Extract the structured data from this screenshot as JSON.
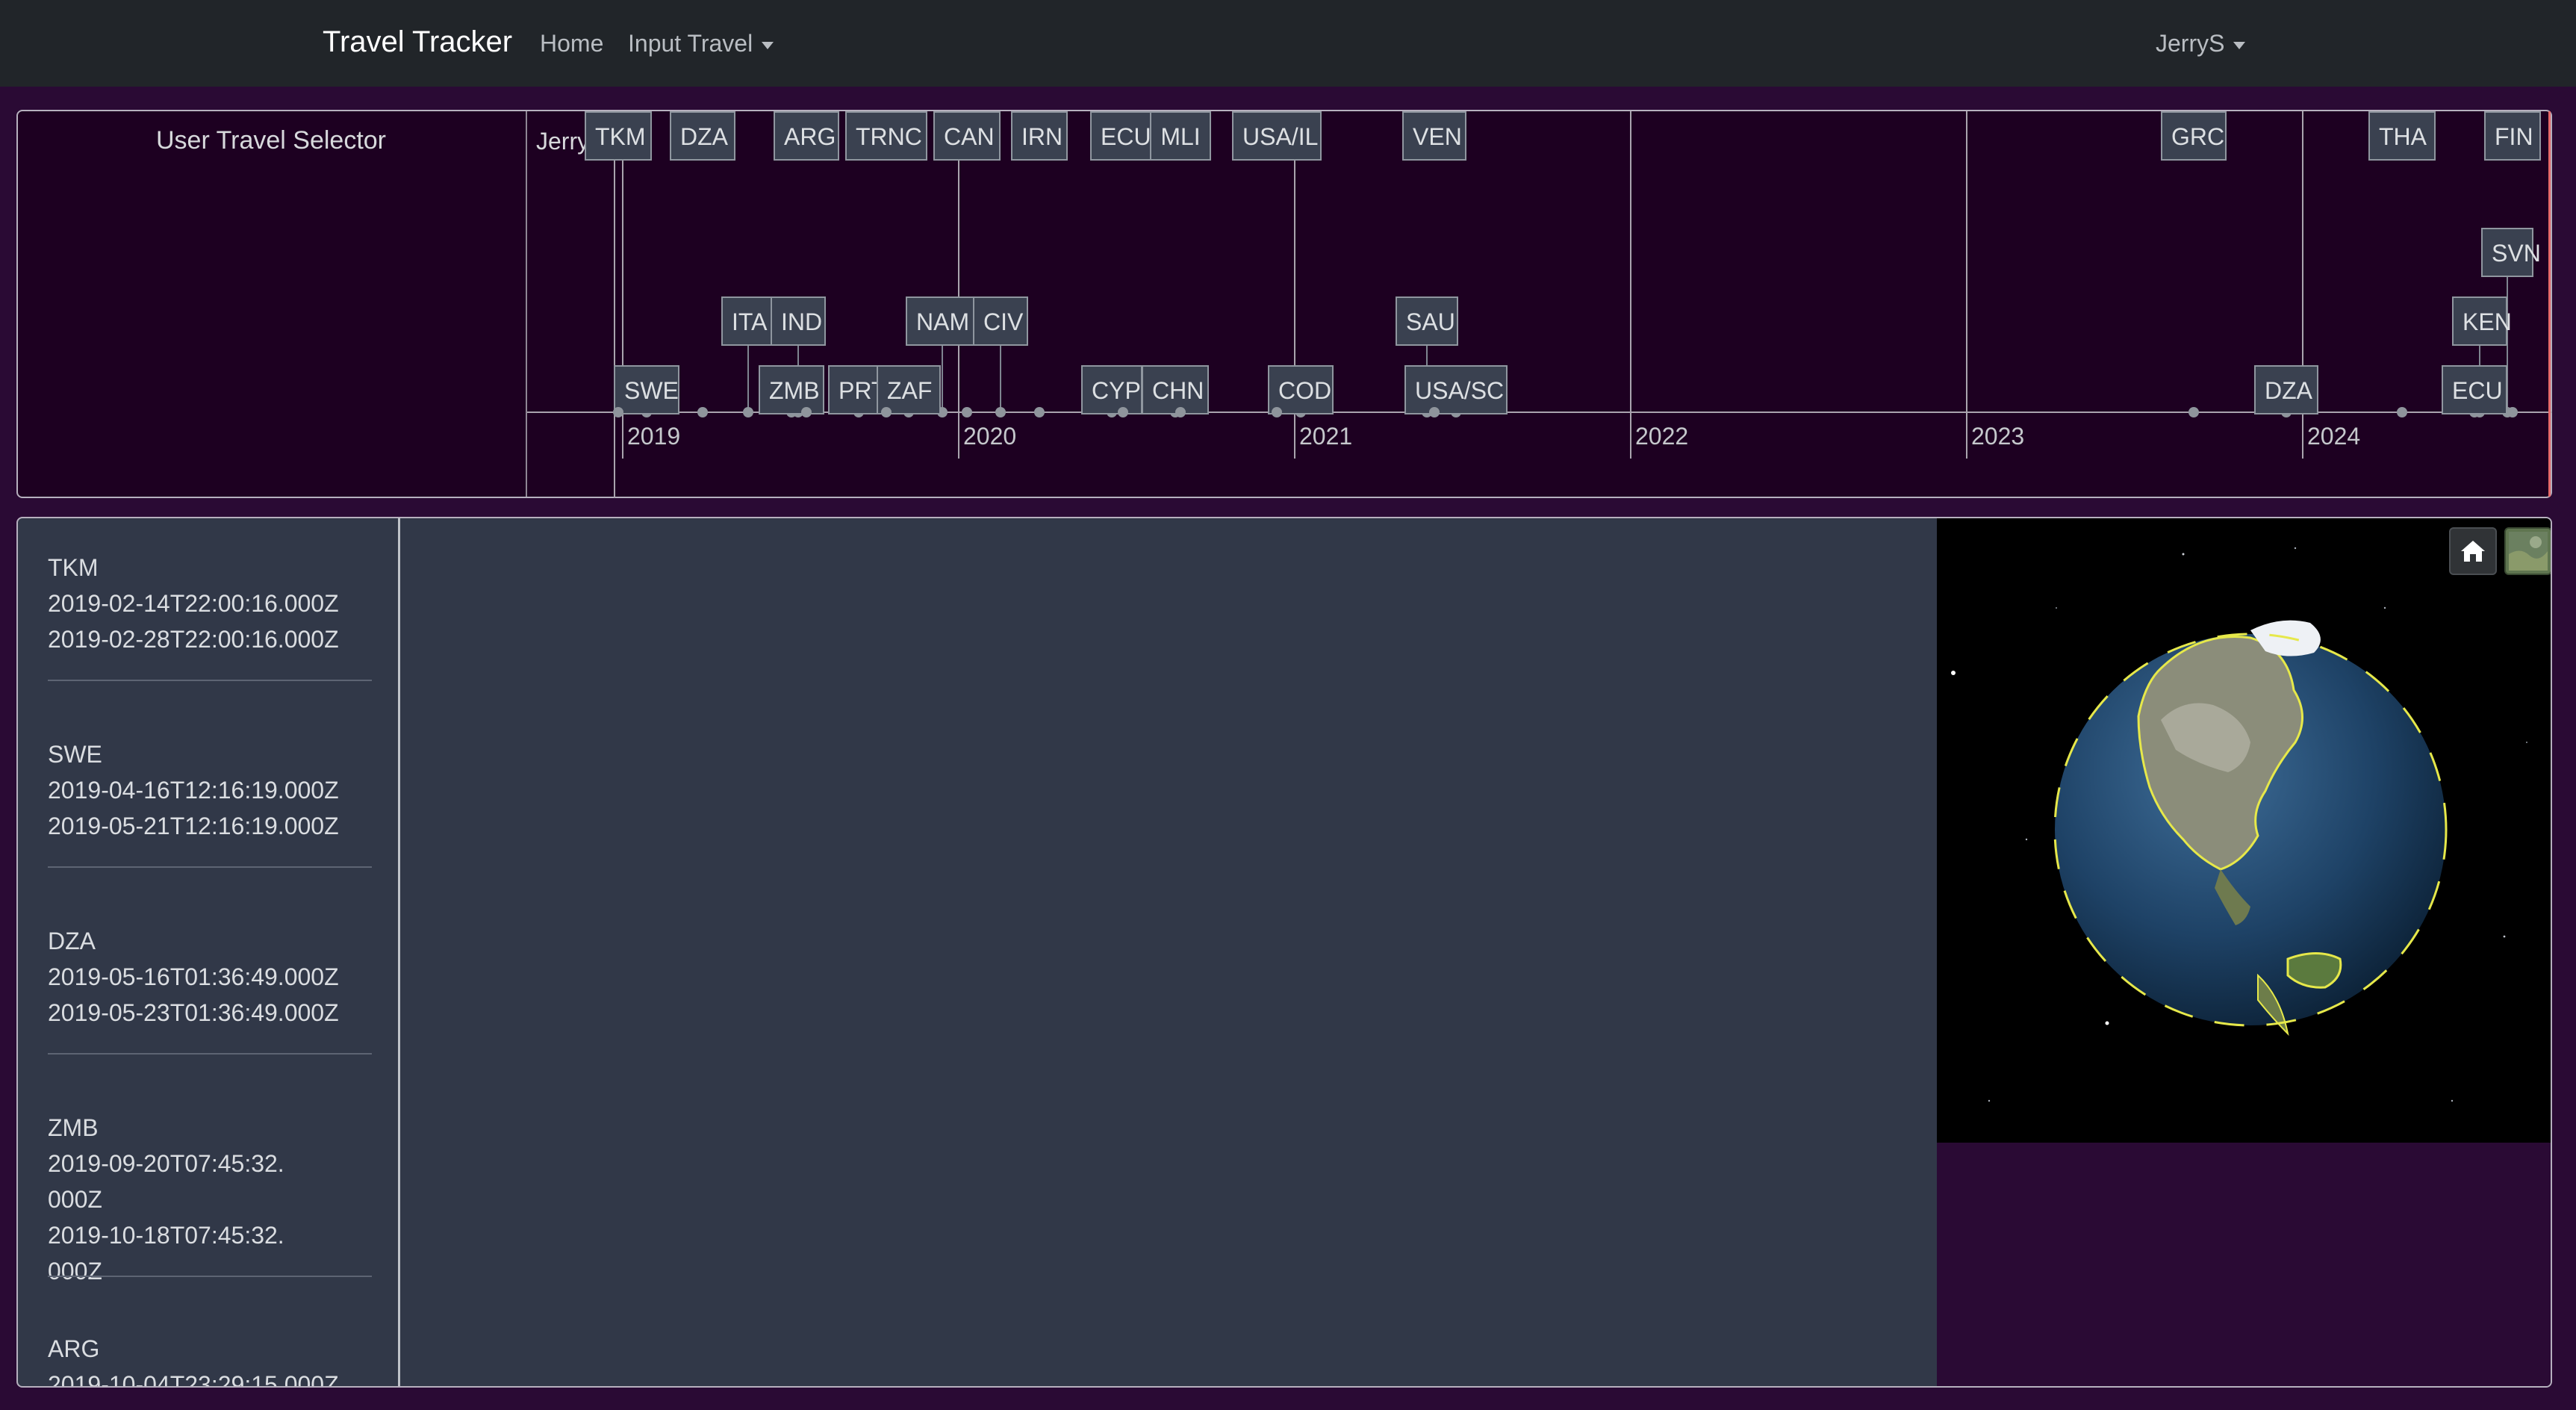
{
  "navbar": {
    "brand": "Travel Tracker",
    "home": "Home",
    "input_travel": "Input Travel",
    "user": "JerryS"
  },
  "selector": {
    "title": "User Travel Selector",
    "user": "JerryS"
  },
  "timeline": {
    "years": [
      "2019",
      "2020",
      "2021",
      "2022",
      "2023",
      "2024"
    ],
    "tags": [
      "SVN",
      "ITA",
      "IND",
      "NAM",
      "CIV",
      "SAU",
      "KEN",
      "SWE",
      "ZMB",
      "PRT",
      "ZAF",
      "CYP",
      "CHN",
      "COD",
      "USA/SC",
      "DZA",
      "ECU",
      "TKM",
      "DZA",
      "ARG",
      "TRNC",
      "CAN",
      "IRN",
      "ECU",
      "MLI",
      "USA/IL",
      "VEN",
      "GRC",
      "THA",
      "FIN"
    ]
  },
  "trips": [
    {
      "code": "TKM",
      "start": "2019-02-14T22:00:16.000Z",
      "end": "2019-02-28T22:00:16.000Z"
    },
    {
      "code": "SWE",
      "start": "2019-04-16T12:16:19.000Z",
      "end": "2019-05-21T12:16:19.000Z"
    },
    {
      "code": "DZA",
      "start": "2019-05-16T01:36:49.000Z",
      "end": "2019-05-23T01:36:49.000Z"
    },
    {
      "code": "ZMB",
      "start": "2019-09-20T07:45:32.000Z",
      "end": "2019-10-18T07:45:32.000Z"
    },
    {
      "code": "ARG",
      "start": "2019-10-04T23:29:15.000Z",
      "end": ""
    }
  ],
  "globe": {
    "home_icon": "home-icon",
    "layer_icon": "map-layer-icon"
  },
  "colors": {
    "background": "#2a0a34",
    "navbar": "#212529",
    "panel": "#1d0021",
    "content": "#313848",
    "tag": "#3a4150",
    "now_line": "#e66a6a",
    "borders_highlight": "#e6e84a"
  }
}
